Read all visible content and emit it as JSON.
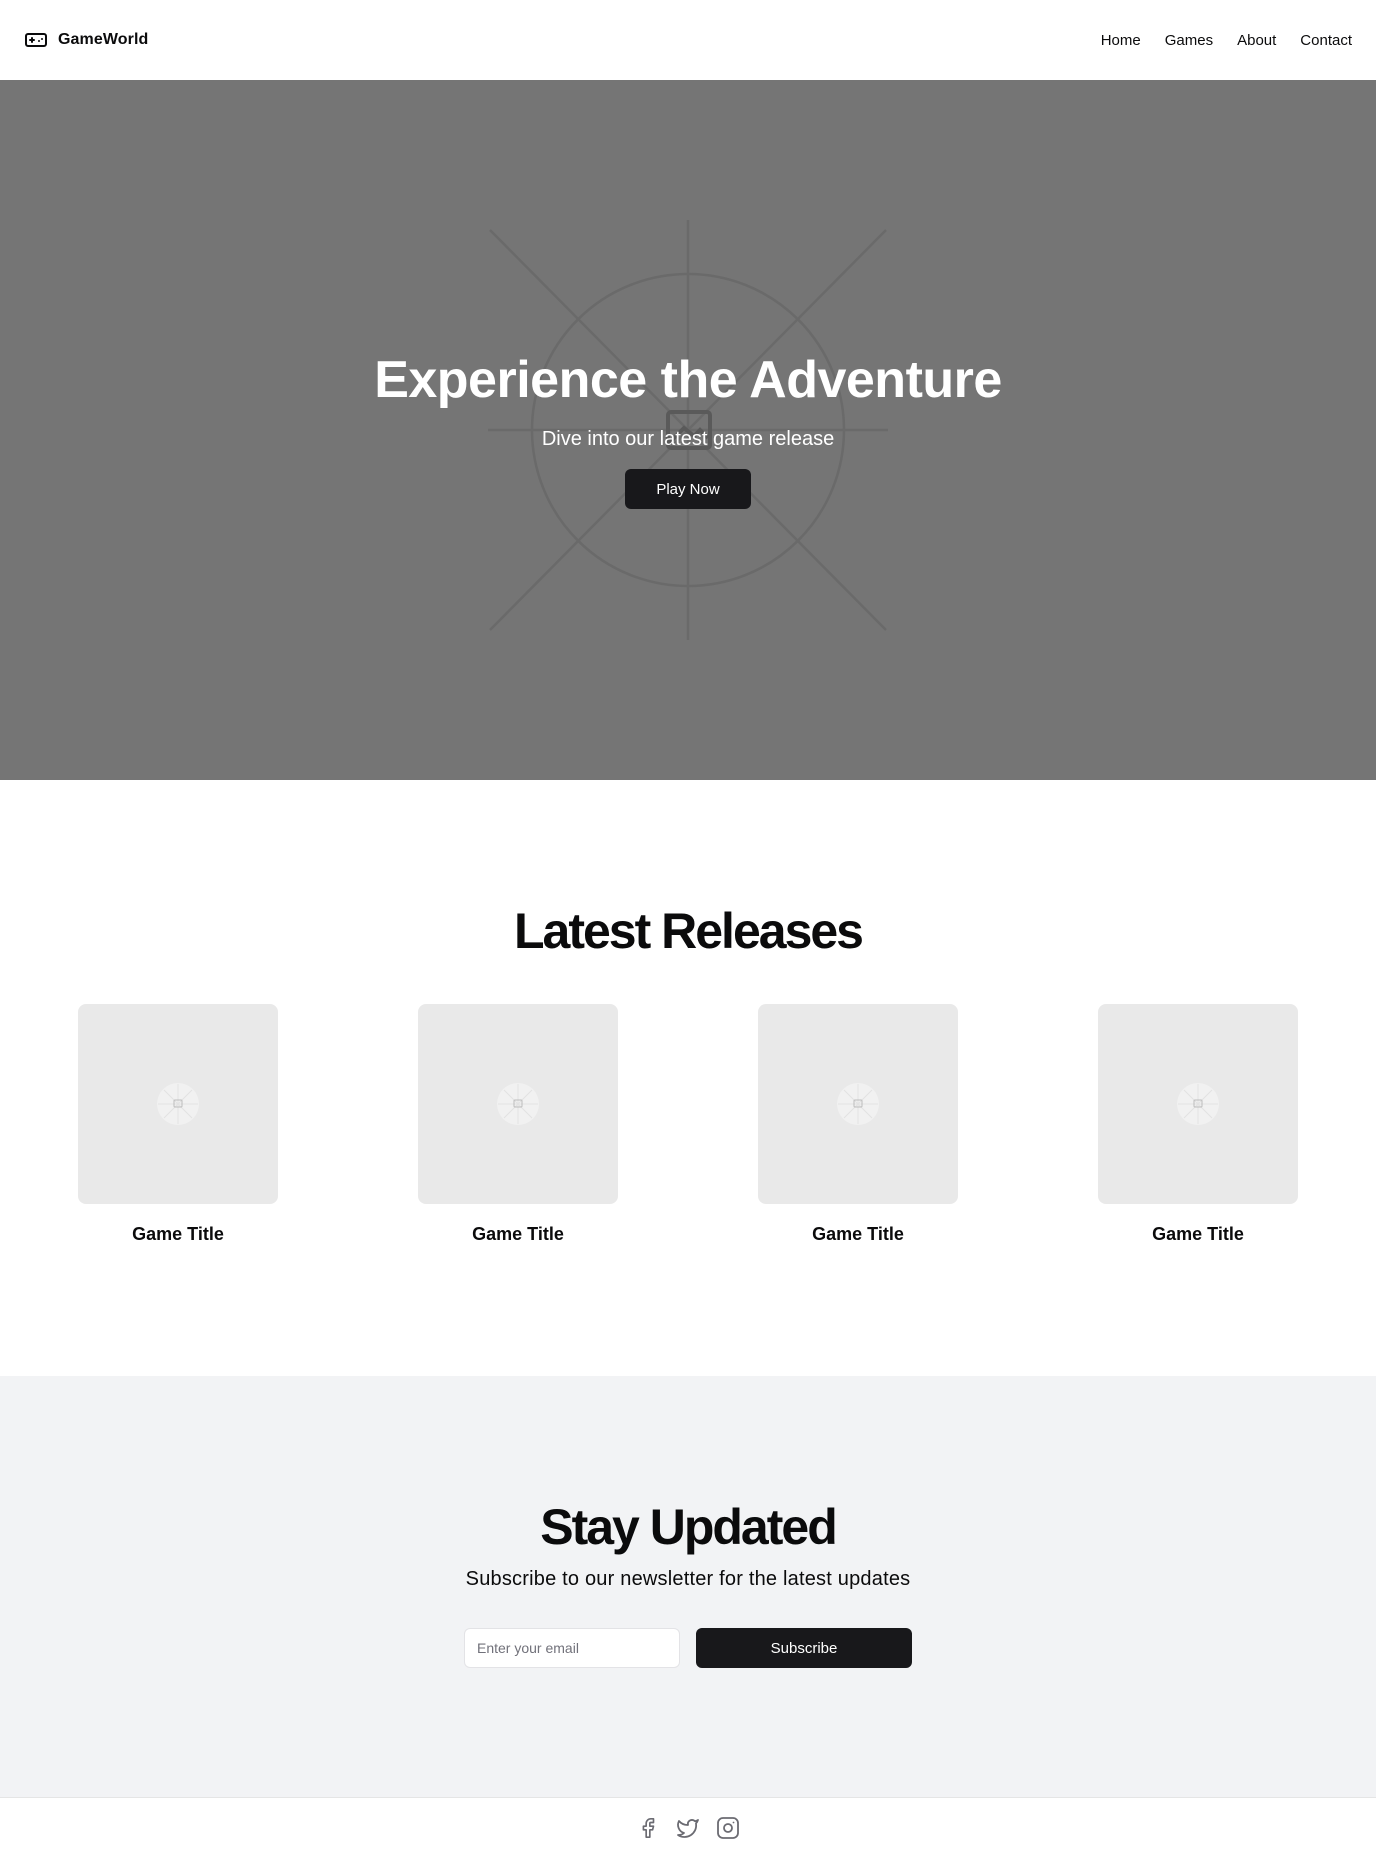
{
  "header": {
    "brand": "GameWorld",
    "brand_icon": "gamepad-icon",
    "nav": [
      "Home",
      "Games",
      "About",
      "Contact"
    ]
  },
  "hero": {
    "title": "Experience the Adventure",
    "subtitle": "Dive into our latest game release",
    "cta": "Play Now",
    "background_color": "#757575",
    "image_icon": "image-placeholder-icon"
  },
  "releases": {
    "title": "Latest Releases",
    "games": [
      {
        "title": "Game Title",
        "image_icon": "image-placeholder-icon"
      },
      {
        "title": "Game Title",
        "image_icon": "image-placeholder-icon"
      },
      {
        "title": "Game Title",
        "image_icon": "image-placeholder-icon"
      },
      {
        "title": "Game Title",
        "image_icon": "image-placeholder-icon"
      }
    ]
  },
  "newsletter": {
    "title": "Stay Updated",
    "subtitle": "Subscribe to our newsletter for the latest updates",
    "email_placeholder": "Enter your email",
    "email_value": "",
    "button": "Subscribe",
    "background_color": "#f2f3f5"
  },
  "footer": {
    "social_icons": [
      "facebook-icon",
      "twitter-icon",
      "instagram-icon"
    ]
  },
  "colors": {
    "primary_button": "#18181b",
    "text": "#0b0b0c"
  }
}
